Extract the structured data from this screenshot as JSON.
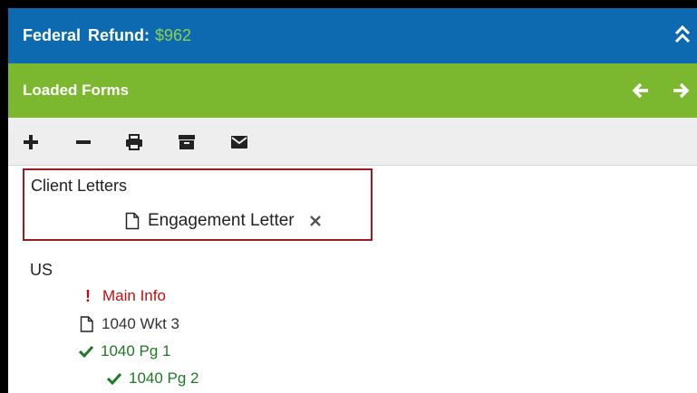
{
  "header": {
    "federal_label": "Federal",
    "refund_label": "Refund:",
    "refund_value": "$962",
    "collapse_icon": "double-chevron-up-icon"
  },
  "loaded_forms": {
    "title": "Loaded Forms",
    "nav_icons": [
      "arrow-left-icon",
      "arrow-right-icon"
    ]
  },
  "toolbar": {
    "icons": [
      "plus-icon",
      "minus-icon",
      "print-icon",
      "archive-icon",
      "envelope-icon"
    ]
  },
  "client_letters": {
    "title": "Client Letters",
    "items": [
      {
        "label": "Engagement Letter",
        "icon": "document-icon",
        "action_icon": "close-icon"
      }
    ]
  },
  "us": {
    "title": "US",
    "items": [
      {
        "label": "Main Info",
        "status": "error",
        "icon": "exclamation-icon"
      },
      {
        "label": "1040 Wkt 3",
        "status": "none",
        "icon": "document-icon"
      },
      {
        "label": "1040 Pg 1",
        "status": "complete",
        "icon": "check-icon"
      },
      {
        "label": "1040 Pg 2",
        "status": "complete",
        "icon": "check-icon"
      }
    ]
  },
  "colors": {
    "header_blue": "#0d6ab0",
    "refund_green": "#8ed04b",
    "loaded_green": "#7cb82f",
    "error_red": "#c20e0e",
    "complete_green": "#1e7a23",
    "highlight_border": "#9b1c1f"
  }
}
